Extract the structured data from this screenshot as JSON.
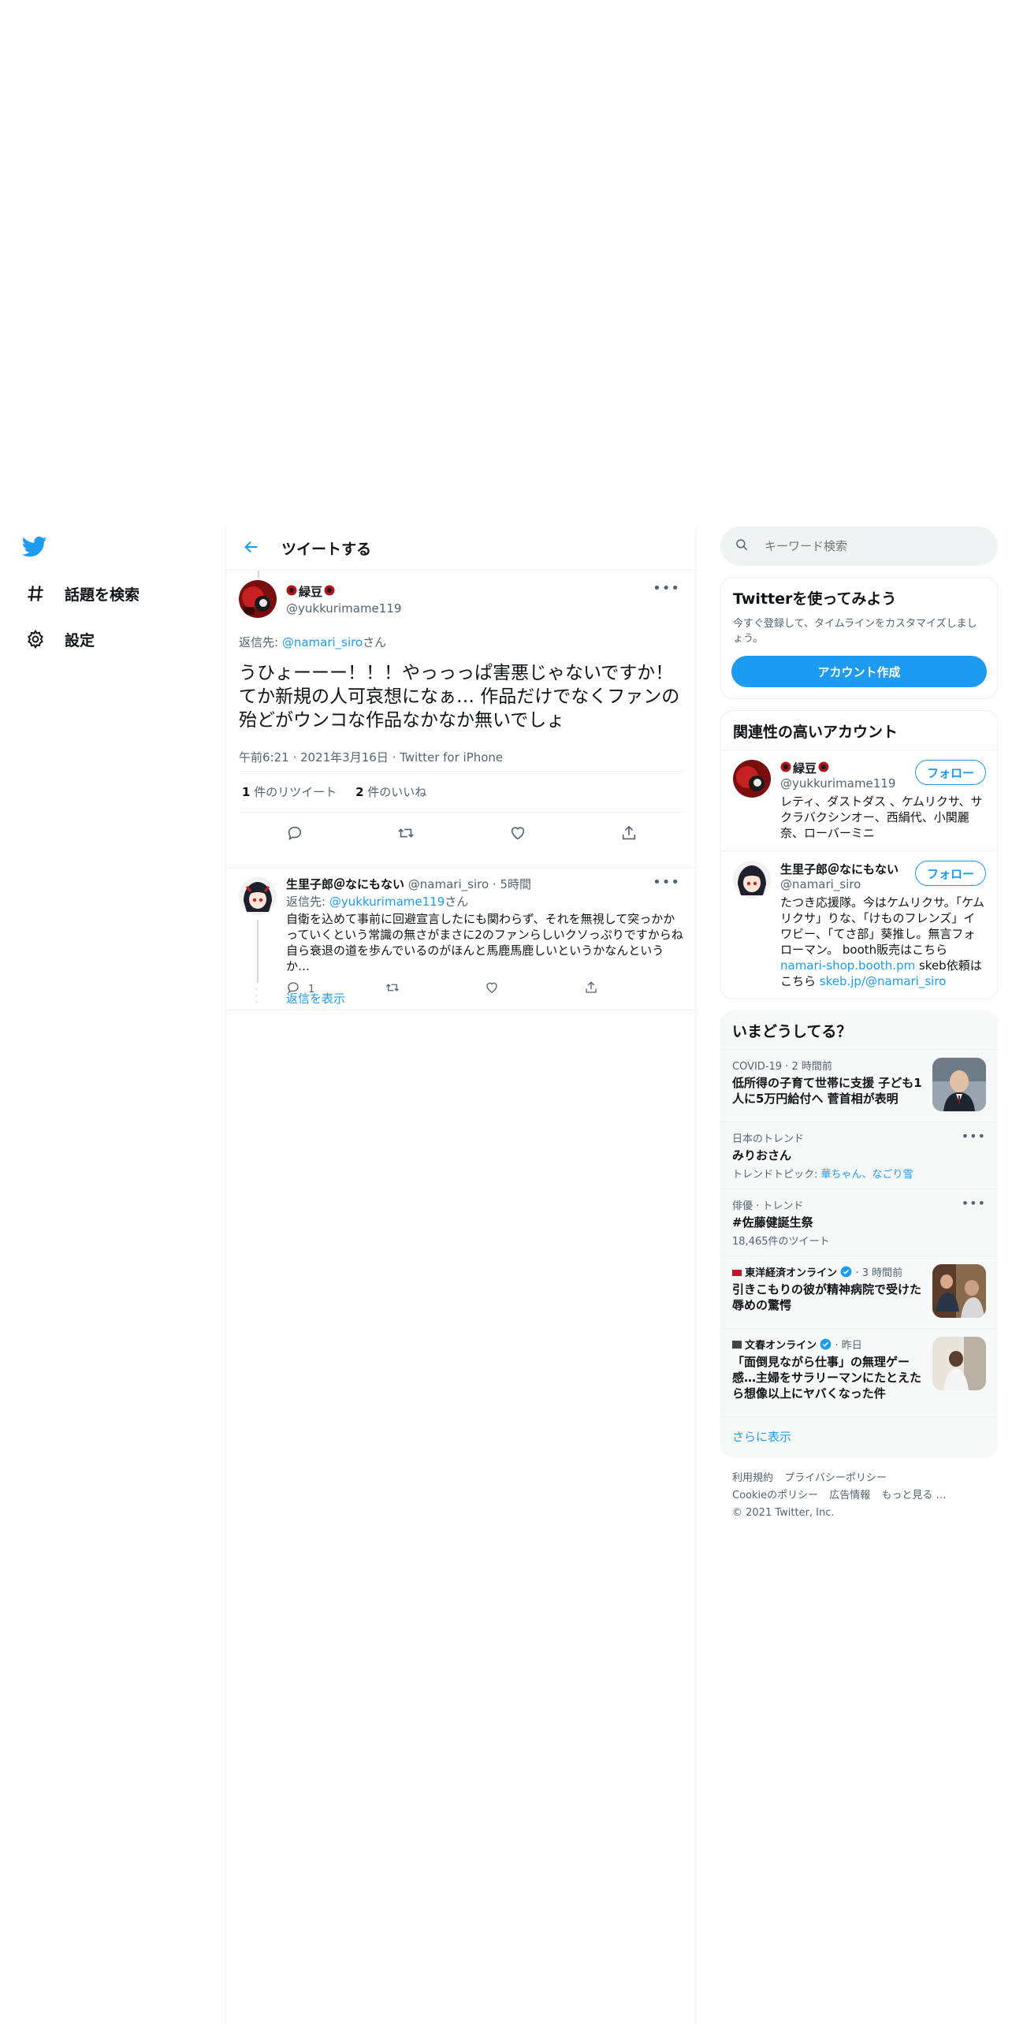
{
  "nav": {
    "items": [
      {
        "label": "話題を検索",
        "icon": "hashtag-icon"
      },
      {
        "label": "設定",
        "icon": "gear-icon"
      }
    ]
  },
  "header": {
    "title": "ツイートする"
  },
  "main_tweet": {
    "name": "緑豆",
    "handle": "@yukkurimame119",
    "reply_prefix": "返信先: ",
    "reply_to": "@namari_siro",
    "reply_suffix": "さん",
    "text": "うひょーーー！！！やっっっぱ害悪じゃないですか！\nてか新規の人可哀想になぁ… 作品だけでなくファンの殆どがウンコな作品なかなか無いでしょ",
    "meta": "午前6:21 · 2021年3月16日 · Twitter for iPhone",
    "retweets_count": "1",
    "retweets_label": " 件のリツイート",
    "likes_count": "2",
    "likes_label": " 件のいいね"
  },
  "reply_tweet": {
    "name": "生里子郎＠なにもない",
    "handle": "@namari_siro",
    "time": "· 5時間",
    "reply_prefix": "返信先: ",
    "reply_to": "@yukkurimame119",
    "reply_suffix": "さん",
    "text": "自衛を込めて事前に回避宣言したにも関わらず、それを無視して突っかかっていくという常識の無さがまさに2のファンらしいクソっぷりですからね 自ら衰退の道を歩んでいるのがほんと馬鹿馬鹿しいというかなんというか…",
    "reply_count": "1",
    "show_replies": "返信を表示"
  },
  "search": {
    "placeholder": "キーワード検索"
  },
  "signup": {
    "title": "Twitterを使ってみよう",
    "desc": "今すぐ登録して、タイムラインをカスタマイズしましょう。",
    "button": "アカウント作成"
  },
  "related": {
    "title": "関連性の高いアカウント",
    "follow_label": "フォロー",
    "accounts": [
      {
        "name": "緑豆",
        "handle": "@yukkurimame119",
        "bio": "レティ、ダストダス 、ケムリクサ、サクラバクシンオー、西絹代、小関麗奈、ローバーミニ"
      },
      {
        "name": "生里子郎＠なにもない",
        "handle": "@namari_siro",
        "bio_a": "たつき応援隊。今はケムリクサ。「ケムリクサ」りな、「けものフレンズ」イワビー、「てさ部」葵推し。無言フォローマン。 booth販売はこちら",
        "bio_link1": "namari-shop.booth.pm",
        "bio_b": " skeb依頼はこちら ",
        "bio_link2": "skeb.jp/@namari_siro"
      }
    ]
  },
  "trends": {
    "title": "いまどうしてる？",
    "items": [
      {
        "ctx": "COVID-19 · 2 時間前",
        "title": "低所得の子育て世帯に支援 子ども1人に5万円給付へ 菅首相が表明"
      },
      {
        "ctx": "日本のトレンド",
        "title": "みりおさん",
        "sub_prefix": "トレンドトピック: ",
        "sub_links": "華ちゃん、なごり雪"
      },
      {
        "ctx": "俳優 · トレンド",
        "title": "#佐藤健誕生祭",
        "sub": "18,465件のツイート"
      },
      {
        "source": "東洋経済オンライン",
        "time": "· 3 時間前",
        "title": "引きこもりの彼が精神病院で受けた辱めの驚愕"
      },
      {
        "source": "文春オンライン",
        "time": "· 昨日",
        "title": "「面倒見ながら仕事」の無理ゲー感…主婦をサラリーマンにたとえたら想像以上にヤバくなった件"
      }
    ],
    "show_more": "さらに表示"
  },
  "footer": {
    "links": [
      "利用規約",
      "プライバシーポリシー",
      "Cookieのポリシー",
      "広告情報",
      "もっと見る …"
    ],
    "copyright": "© 2021 Twitter, Inc."
  },
  "colors": {
    "accent": "#1d9bf0",
    "text": "#0f1419",
    "secondary": "#536471",
    "border": "#eff3f4"
  }
}
